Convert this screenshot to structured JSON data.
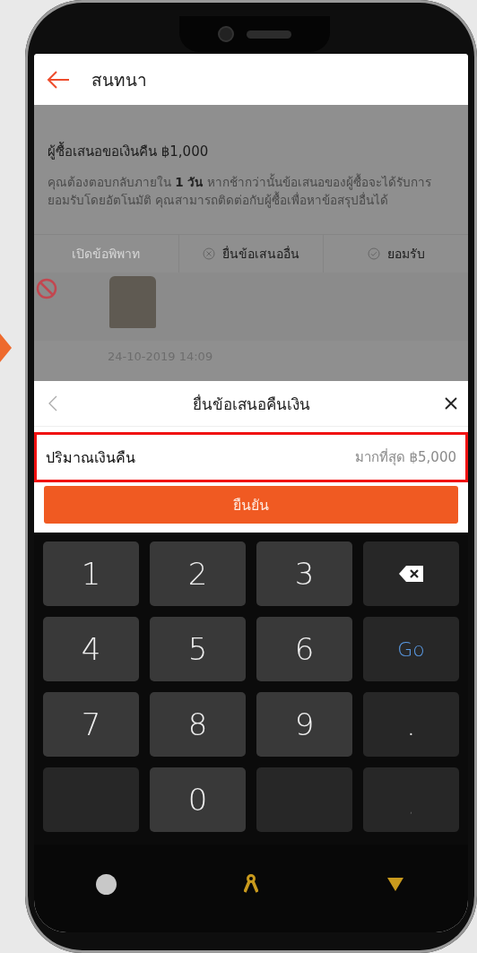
{
  "header": {
    "title": "สนทนา"
  },
  "offer": {
    "title": "ผู้ซื้อเสนอขอเงินคืน ฿1,000",
    "description": "คุณต้องตอบกลับภายใน **1 วัน** หากช้ากว่านั้นข้อเสนอของผู้ซื้อจะได้รับการยอมรับโดยอัตโนมัติ คุณสามารถติดต่อกับผู้ซื้อเพื่อหาข้อสรุปอื่นได้",
    "actions": [
      {
        "label": "เปิดข้อพิพาท",
        "kind": "plain",
        "disabled": true
      },
      {
        "label": "ยื่นข้อเสนออื่น",
        "kind": "decline",
        "disabled": false
      },
      {
        "label": "ยอมรับ",
        "kind": "accept",
        "disabled": false
      }
    ],
    "timestamp": "24-10-2019 14:09"
  },
  "sheet": {
    "title": "ยื่นข้อเสนอคืนเงิน",
    "field_label": "ปริมาณเงินคืน",
    "placeholder": "มากที่สุด ฿5,000",
    "highlighted": true,
    "confirm": "ยืนยัน"
  },
  "keys": [
    {
      "kind": "digit",
      "label": "1"
    },
    {
      "kind": "digit",
      "label": "2"
    },
    {
      "kind": "digit",
      "label": "3"
    },
    {
      "kind": "delete"
    },
    {
      "kind": "digit",
      "label": "4"
    },
    {
      "kind": "digit",
      "label": "5"
    },
    {
      "kind": "digit",
      "label": "6"
    },
    {
      "kind": "go",
      "label": "Go"
    },
    {
      "kind": "digit",
      "label": "7"
    },
    {
      "kind": "digit",
      "label": "8"
    },
    {
      "kind": "digit",
      "label": "9"
    },
    {
      "kind": "symbol",
      "label": "."
    },
    {
      "kind": "blank"
    },
    {
      "kind": "digit",
      "label": "0"
    },
    {
      "kind": "blank"
    },
    {
      "kind": "small",
      "label": ","
    }
  ]
}
